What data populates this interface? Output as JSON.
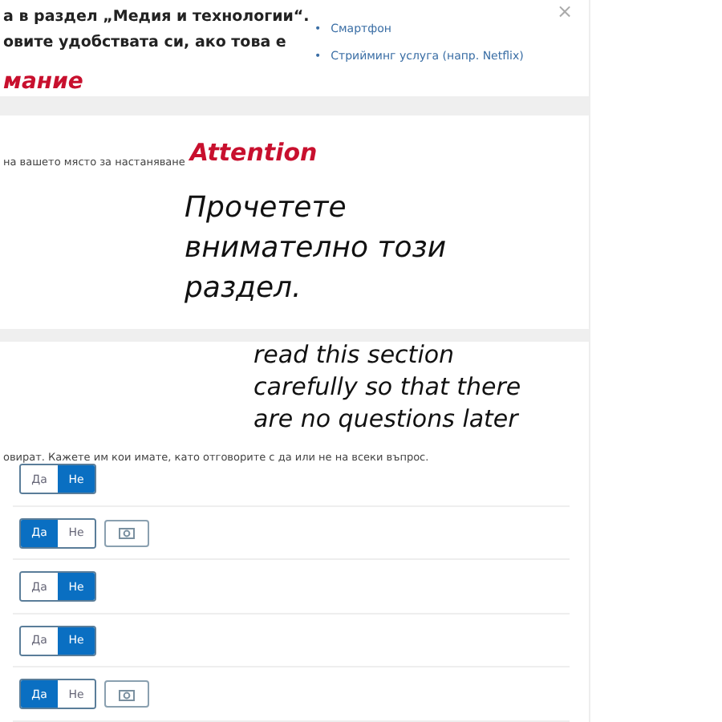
{
  "intro": {
    "lines": [
      "а в раздел „Медия и технологии“.",
      "овите удобствата си, ако това е"
    ],
    "bullet": "•",
    "bullets": [
      "Смартфон",
      "Стрийминг услуга (напр. Netflix)"
    ],
    "close": "×"
  },
  "annotation_top": "мание",
  "section1": {
    "text": "на вашето място за настаняване",
    "annotation": "Attention",
    "note": "Прочетете внимателно този раздел."
  },
  "section2": {
    "note": "read this section carefully so that there are no questions later",
    "text": "овират. Кажете им кои имате, като отговорите с да или не на всеки въпрос.",
    "rows": [
      {
        "options": [
          {
            "label": "Да",
            "selected": false
          },
          {
            "label": "Не",
            "selected": true
          }
        ],
        "camera": false
      },
      {
        "options": [
          {
            "label": "Да",
            "selected": true
          },
          {
            "label": "Не",
            "selected": false
          }
        ],
        "camera": true
      },
      {
        "options": [
          {
            "label": "Да",
            "selected": false
          },
          {
            "label": "Не",
            "selected": true
          }
        ],
        "camera": false
      },
      {
        "options": [
          {
            "label": "Да",
            "selected": false
          },
          {
            "label": "Не",
            "selected": true
          }
        ],
        "camera": false
      },
      {
        "options": [
          {
            "label": "Да",
            "selected": true
          },
          {
            "label": "Не",
            "selected": false
          }
        ],
        "camera": true
      }
    ]
  }
}
